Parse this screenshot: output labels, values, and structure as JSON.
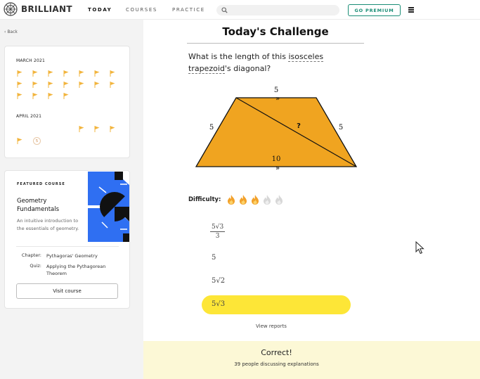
{
  "nav": {
    "brand": "BRILLIANT",
    "links": [
      "TODAY",
      "COURSES",
      "PRACTICE"
    ],
    "search_placeholder": "",
    "premium_label": "GO PREMIUM"
  },
  "sidebar": {
    "back_label": "Back",
    "calendar": {
      "months": [
        {
          "label": "MARCH 2021",
          "completed_days": 18
        },
        {
          "label": "APRIL 2021",
          "completed_days": 4,
          "current_day": "5"
        }
      ],
      "flag_color": "#f2b43d"
    },
    "featured": {
      "eyebrow": "FEATURED COURSE",
      "title": "Geometry Fundamentals",
      "description": "An intuitive introduction to the essentials of geometry.",
      "chapter_label": "Chapter:",
      "chapter_value": "Pythagoras' Geometry",
      "quiz_label": "Quiz:",
      "quiz_value": "Applying the Pythagorean Theorem",
      "button_label": "Visit course"
    }
  },
  "challenge": {
    "title": "Today's Challenge",
    "question_prefix": "What is the length of this ",
    "question_term": "isosceles trapezoid",
    "question_suffix": "'s diagonal?",
    "figure": {
      "top_label": "5",
      "left_label": "5",
      "right_label": "5",
      "bottom_label": "10",
      "diagonal_label": "?",
      "parallel_mark": "»",
      "fill_color": "#f0a420"
    },
    "difficulty_label": "Difficulty:",
    "difficulty_level": 3,
    "difficulty_max": 5,
    "choices": [
      {
        "numerator": "5√3",
        "denominator": "3"
      },
      {
        "value": "5"
      },
      {
        "value": "5√2"
      },
      {
        "value": "5√3",
        "selected": true
      }
    ],
    "selected_color": "#fde637",
    "view_reports": "View reports",
    "result_title": "Correct!",
    "result_sub": "39 people discussing explanations",
    "result_bg": "#fcf8d6"
  }
}
